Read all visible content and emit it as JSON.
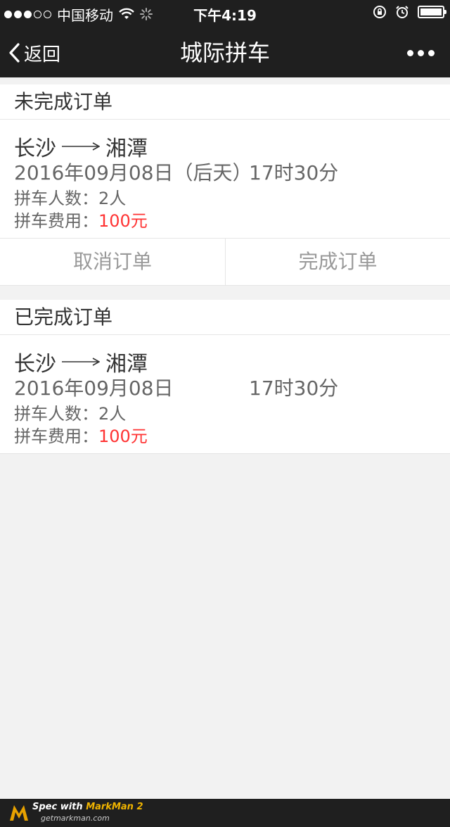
{
  "status_bar": {
    "carrier": "中国移动",
    "time": "下午4:19"
  },
  "nav": {
    "back_label": "返回",
    "title": "城际拼车"
  },
  "pending": {
    "header": "未完成订单",
    "order": {
      "from": "长沙",
      "to": "湘潭",
      "date": "2016年09月08日（后天）",
      "time": "17时30分",
      "people_label": "拼车人数：",
      "people_value": "2人",
      "fee_label": "拼车费用：",
      "fee_value": "100元"
    },
    "cancel_label": "取消订单",
    "complete_label": "完成订单"
  },
  "completed": {
    "header": "已完成订单",
    "order": {
      "from": "长沙",
      "to": "湘潭",
      "date": "2016年09月08日",
      "time": "17时30分",
      "people_label": "拼车人数：",
      "people_value": "2人",
      "fee_label": "拼车费用：",
      "fee_value": "100元"
    }
  },
  "footer": {
    "spec_prefix": "Spec with ",
    "brand": "MarkMan 2",
    "site": "getmarkman.com"
  },
  "colors": {
    "text_primary": "#333333",
    "text_secondary": "#666666",
    "accent_red": "#ff3333",
    "button_text": "#999999"
  }
}
